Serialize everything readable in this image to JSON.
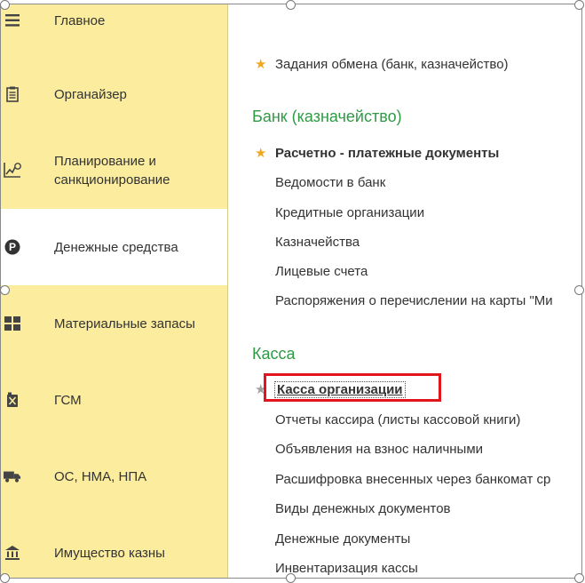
{
  "sidebar": {
    "items": [
      {
        "label": "Главное",
        "icon": "hamburger-menu-icon"
      },
      {
        "label": "Органайзер",
        "icon": "clipboard-icon"
      },
      {
        "label": "Планирование и санкционирование",
        "icon": "planning-chart-icon"
      },
      {
        "label": "Денежные средства",
        "icon": "ruble-coin-icon",
        "active": true
      },
      {
        "label": "Материальные запасы",
        "icon": "grid-icon"
      },
      {
        "label": "ГСМ",
        "icon": "fuel-canister-icon"
      },
      {
        "label": "ОС, НМА, НПА",
        "icon": "truck-icon"
      },
      {
        "label": "Имущество казны",
        "icon": "bank-building-icon"
      }
    ]
  },
  "content": {
    "top_link": "Задания обмена (банк, казначейство)",
    "bank_section": {
      "title": "Банк (казначейство)",
      "items": [
        "Расчетно - платежные документы",
        "Ведомости в банк",
        "Кредитные организации",
        "Казначейства",
        "Лицевые счета",
        "Распоряжения о перечислении на карты \"Ми"
      ]
    },
    "cash_section": {
      "title": "Касса",
      "items": [
        "Касса организации",
        "Отчеты кассира (листы кассовой книги)",
        "Объявления на взнос наличными",
        "Расшифровка внесенных через банкомат ср",
        "Виды денежных документов",
        "Денежные документы",
        "Инвентаризация кассы"
      ]
    }
  },
  "colors": {
    "sidebar_bg": "#fbec9e",
    "section_title": "#2e9a43",
    "favorite_star": "#f0a81e",
    "highlight_border": "#e3141b"
  }
}
